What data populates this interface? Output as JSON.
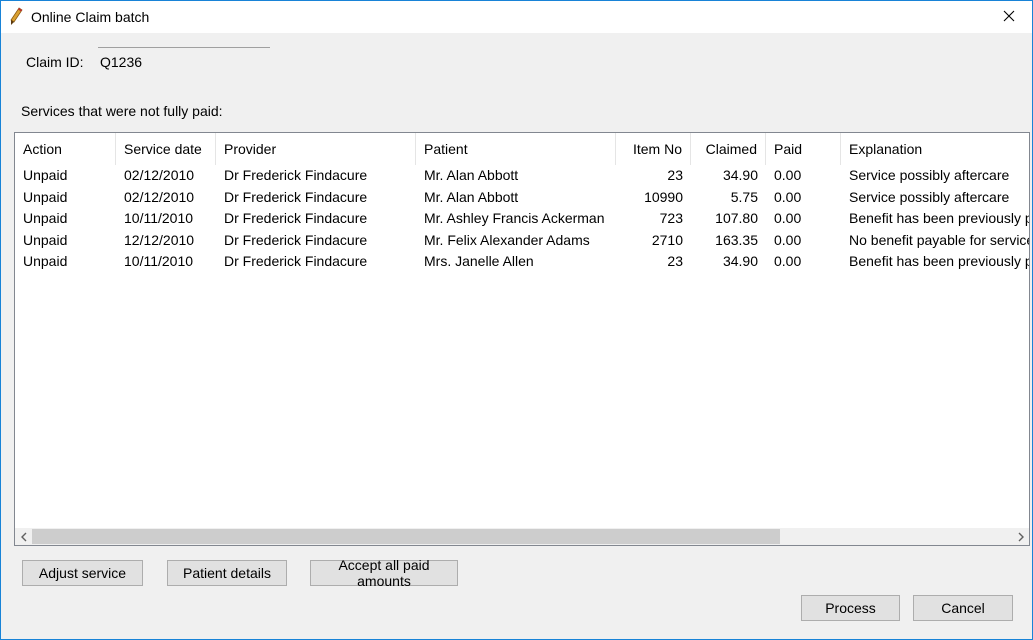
{
  "window": {
    "title": "Online Claim batch",
    "icons": {
      "app": "pencil-icon",
      "close": "close-icon"
    }
  },
  "claim": {
    "label": "Claim ID:",
    "value": "Q1236"
  },
  "services_label": "Services that were not fully paid:",
  "table": {
    "columns": [
      "Action",
      "Service date",
      "Provider",
      "Patient",
      "Item No",
      "Claimed",
      "Paid",
      "Explanation"
    ],
    "rows": [
      [
        "Unpaid",
        "02/12/2010",
        "Dr Frederick Findacure",
        "Mr. Alan Abbott",
        "23",
        "34.90",
        "0.00",
        "Service possibly aftercare"
      ],
      [
        "Unpaid",
        "02/12/2010",
        "Dr Frederick Findacure",
        "Mr. Alan Abbott",
        "10990",
        "5.75",
        "0.00",
        "Service possibly aftercare"
      ],
      [
        "Unpaid",
        "10/11/2010",
        "Dr Frederick Findacure",
        "Mr. Ashley Francis Ackerman",
        "723",
        "107.80",
        "0.00",
        "Benefit has been previously paid"
      ],
      [
        "Unpaid",
        "12/12/2010",
        "Dr Frederick Findacure",
        "Mr. Felix Alexander Adams",
        "2710",
        "163.35",
        "0.00",
        "No benefit payable for services"
      ],
      [
        "Unpaid",
        "10/11/2010",
        "Dr Frederick Findacure",
        "Mrs. Janelle Allen",
        "23",
        "34.90",
        "0.00",
        "Benefit has been previously paid"
      ]
    ]
  },
  "buttons": {
    "adjust": "Adjust service",
    "patient": "Patient details",
    "accept": "Accept all paid amounts",
    "process": "Process",
    "cancel": "Cancel"
  },
  "colors": {
    "window_border": "#1883d7",
    "background": "#f0f0f0",
    "button_face": "#e1e1e1",
    "scroll_thumb": "#cdcdcd"
  }
}
